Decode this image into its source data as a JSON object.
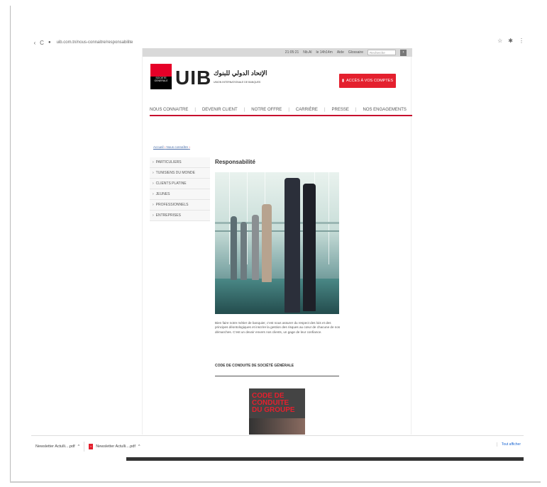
{
  "browser": {
    "url": "uib.com.tn/nous-connaitre/responsabilite",
    "back_glyph": "‹",
    "reload_glyph": "C",
    "icons": [
      "star-icon",
      "extension-icon",
      "menu-icon"
    ]
  },
  "topbar": {
    "links": [
      "21:05:21",
      "Nb.Al",
      "le 14h14m",
      "Aide",
      "Glossaire"
    ],
    "search_placeholder": "Recherche"
  },
  "brand": {
    "logo_text": "SOCIETE GENERALE",
    "name": "UIB",
    "arabic_name": "الإتحاد الدولي للبنوك",
    "subname": "UNION INTERNATIONALE DE BANQUES"
  },
  "access_button": {
    "label": "ACCÈS À VOS COMPTES"
  },
  "mainnav": {
    "items": [
      "NOUS CONNAITRE",
      "DEVENIR CLIENT",
      "NOTRE OFFRE",
      "CARRIÈRE",
      "PRESSE",
      "NOS ENGAGEMENTS"
    ]
  },
  "breadcrumb": {
    "home": "Accueil",
    "current": "Nous connaître"
  },
  "sidebar": {
    "items": [
      "PARTICULIERS",
      "TUNISIENS DU MONDE",
      "CLIENTS PLATINE",
      "JEUNES",
      "PROFESSIONNELS",
      "ENTREPRISES"
    ]
  },
  "content": {
    "title": "Responsabilité",
    "paragraph": "Bien faire notre métier de banquier, c'est nous assurer du respect des lois et des principes déontologiques et inscrire la gestion des risques au cœur de chacune de nos démarches. C'est un devoir envers nos clients, un gage de leur confiance.",
    "code_title": "CODE DE CONDUITE DE SOCIÉTÉ GÉNÉRALE",
    "cover_text": [
      "CODE DE",
      "CONDUITE",
      "DU GROUPE"
    ]
  },
  "downloads": {
    "items": [
      "Newsletter Actulli....pdf",
      "Newsletter Actulli....pdf"
    ],
    "show_all": "Tout afficher"
  },
  "colors": {
    "brand_red": "#e4202e",
    "nav_underline": "#c8102e",
    "link_blue": "#4a6ea9"
  }
}
